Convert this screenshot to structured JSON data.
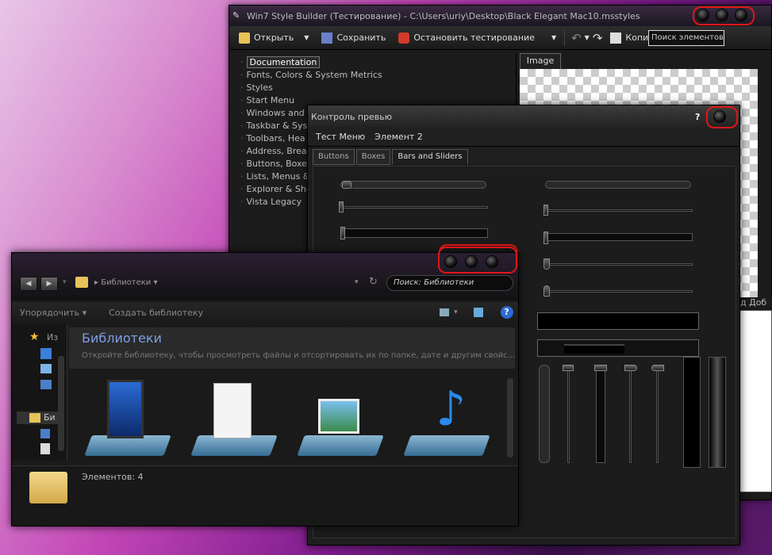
{
  "builder": {
    "title": "Win7 Style Builder (Тестирование) - C:\\Users\\uriy\\Desktop\\Black Elegant Mac10.msstyles",
    "toolbar": {
      "open": "Открыть",
      "save": "Сохранить",
      "stop": "Остановить тестирование",
      "copy": "Копироват",
      "search_placeholder": "Поиск элементов"
    },
    "tree": [
      "Documentation",
      "Fonts, Colors & System Metrics",
      "Styles",
      "Start Menu",
      "Windows and",
      "Taskbar & Sys",
      "Toolbars, Hea",
      "Address, Brea",
      "Buttons, Boxe",
      "Lists, Menus &",
      "Explorer & She",
      "Vista Legacy"
    ],
    "image_tab": "Image",
    "right_cut_label": "д Доб"
  },
  "preview": {
    "title": "Контроль превью",
    "help": "?",
    "menu": [
      "Тест Меню",
      "Элемент 2"
    ],
    "tabs": [
      "Buttons",
      "Boxes",
      "Bars and Sliders"
    ]
  },
  "explorer": {
    "breadcrumb": "Библиотеки",
    "search_placeholder": "Поиск: Библиотеки",
    "commands": [
      "Упорядочить",
      "Создать библиотеку"
    ],
    "nav_items": [
      "Из",
      "Би"
    ],
    "heading": "Библиотеки",
    "subheading": "Откройте библиотеку, чтобы просмотреть файлы и отсортировать их по папке, дате и другим свойс...",
    "libraries": [
      "video-library-icon",
      "documents-library-icon",
      "pictures-library-icon",
      "music-library-icon"
    ],
    "status": "Элементов: 4"
  },
  "colors": {
    "accent_red": "#e01616",
    "heading_blue": "#7d9ee8"
  }
}
